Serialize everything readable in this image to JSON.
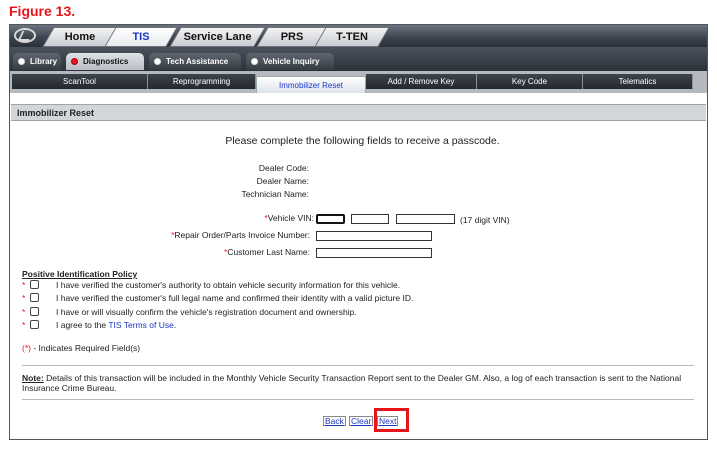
{
  "figure_label": "Figure 13.",
  "top_tabs": [
    {
      "label": "Home"
    },
    {
      "label": "TIS"
    },
    {
      "label": "Service Lane"
    },
    {
      "label": "PRS"
    },
    {
      "label": "T-TEN"
    }
  ],
  "sub_tabs": [
    {
      "label": "Library"
    },
    {
      "label": "Diagnostics"
    },
    {
      "label": "Tech Assistance"
    },
    {
      "label": "Vehicle Inquiry"
    }
  ],
  "tool_tabs": [
    {
      "label": "ScanTool"
    },
    {
      "label": "Reprogramming"
    },
    {
      "label": "Immobilizer Reset"
    },
    {
      "label": "Add / Remove Key"
    },
    {
      "label": "Key Code"
    },
    {
      "label": "Telematics"
    }
  ],
  "panel_title": "Immobilizer Reset",
  "instructions": "Please complete the following fields to receive a passcode.",
  "dealer_code_label": "Dealer Code:",
  "dealer_name_label": "Dealer Name:",
  "technician_name_label": "Technician Name:",
  "vin_label": "Vehicle VIN:",
  "vin_hint": "(17 digit VIN)",
  "repair_order_label": "Repair Order/Parts Invoice Number:",
  "last_name_label": "Customer Last Name:",
  "required_mark": "*",
  "policy_title": "Positive Identification Policy",
  "policy_items": [
    {
      "text": "I have verified the customer's authority to obtain vehicle security information for this vehicle."
    },
    {
      "text": "I have verified the customer's full legal name and confirmed their identity with a valid picture ID."
    },
    {
      "text": "I have or will visually confirm the vehicle's registration document and ownership."
    },
    {
      "text": "I agree to the"
    }
  ],
  "terms_link": "TIS Terms of Use",
  "terms_period": ".",
  "required_note_mark": "(*)",
  "required_note": " - Indicates Required Field(s)",
  "note_label": "Note:",
  "note_text": " Details of this transaction will be included in the Monthly Vehicle Security Transaction Report sent to the Dealer GM. Also, a log of each transaction is sent to the National Insurance Crime Bureau.",
  "buttons": {
    "back": "Back",
    "clear": "Clear",
    "next": "Next"
  },
  "colors": {
    "figure_label": "#e8141b",
    "active_tab_text": "#1a36c4",
    "highlight_box": "#e8141b"
  }
}
